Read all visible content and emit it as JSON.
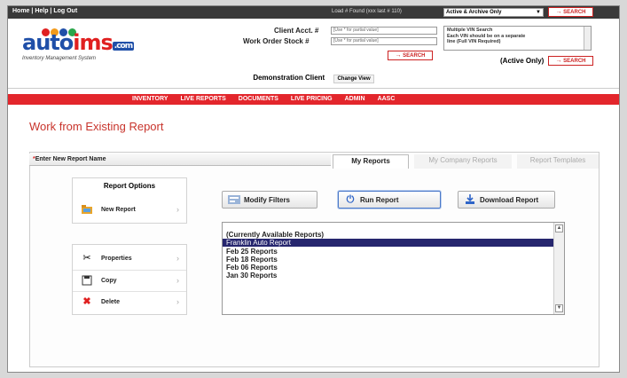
{
  "toplinks": {
    "home": "Home",
    "help": "Help",
    "logout": "Log Out"
  },
  "header": {
    "loaded_status": "Load # Found (xxx last # 110)",
    "record_filter": "Active & Archive Only",
    "search_label": "SEARCH",
    "client_acct_label": "Client Acct. #",
    "client_acct_placeholder": "[Use * for partial value]",
    "work_order_label": "Work Order Stock #",
    "work_order_placeholder": "[Use * for partial value]",
    "vin_lines": [
      "Multiple VIN Search",
      "Each VIN should be on a separate",
      "line (Full VIN Required)"
    ],
    "active_only_label": "(Active Only)"
  },
  "logo": {
    "name_a": "auto",
    "name_b": "ims",
    "suffix": ".com",
    "tagline": "Inventory Management System",
    "colors": [
      "#e02020",
      "#f39a1a",
      "#1f4fa8",
      "#2aa64a"
    ]
  },
  "client": {
    "label": "Demonstration Client",
    "change_view": "Change View"
  },
  "nav": [
    "INVENTORY",
    "LIVE REPORTS",
    "DOCUMENTS",
    "LIVE PRICING",
    "ADMIN",
    "AASC"
  ],
  "page": {
    "title": "Work from Existing Report"
  },
  "report": {
    "name_label": "Enter New Report Name",
    "tabs": [
      "My Reports",
      "My Company Reports",
      "Report Templates"
    ],
    "options_title": "Report Options",
    "new_report": "New Report",
    "menu": [
      "Properties",
      "Copy",
      "Delete"
    ],
    "actions": {
      "modify": "Modify Filters",
      "run": "Run Report",
      "download": "Download Report"
    },
    "list": [
      "(Currently Available Reports)",
      "Franklin Auto Report",
      "Feb 25 Reports",
      "Feb 18 Reports",
      "Feb 06 Reports",
      "Jan 30 Reports"
    ]
  }
}
